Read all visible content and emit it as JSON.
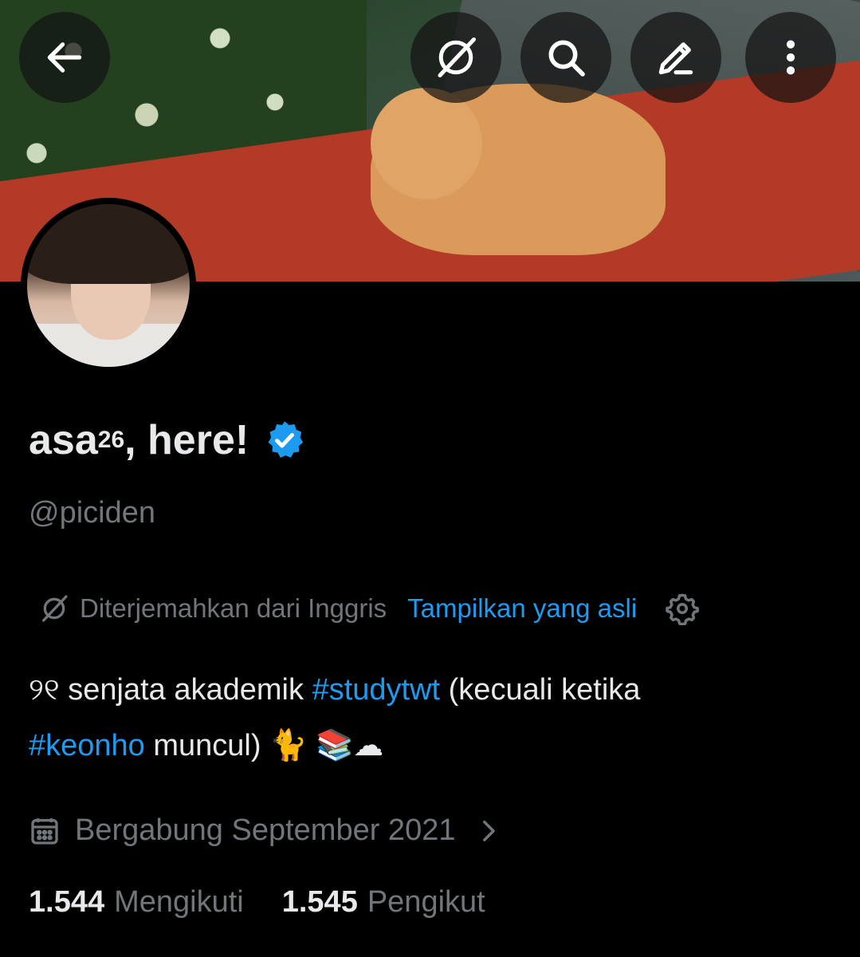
{
  "profile": {
    "display_name": "asa",
    "display_name_sup": "26",
    "display_name_suffix": ", here!",
    "handle": "@piciden",
    "verified": true
  },
  "translation": {
    "note": "Diterjemahkan dari Inggris",
    "show_original": "Tampilkan yang asli"
  },
  "bio": {
    "prefix": "୨୧ senjata akademik ",
    "hashtag1": "#studytwt",
    "middle": " (kecuali ketika",
    "hashtag2": "#keonho",
    "suffix": " muncul) 🐈 📚☁"
  },
  "joined": "Bergabung September 2021",
  "stats": {
    "following_count": "1.544",
    "following_label": "Mengikuti",
    "followers_count": "1.545",
    "followers_label": "Pengikut"
  },
  "colors": {
    "accent": "#1d9bf0",
    "muted": "#71767b",
    "text": "#e7e9ea",
    "background": "#000000"
  },
  "icons": [
    "back-arrow-icon",
    "grok-icon",
    "search-icon",
    "edit-icon",
    "more-icon",
    "verified-badge-icon",
    "grok-translate-icon",
    "gear-icon",
    "calendar-icon",
    "chevron-right-icon"
  ]
}
